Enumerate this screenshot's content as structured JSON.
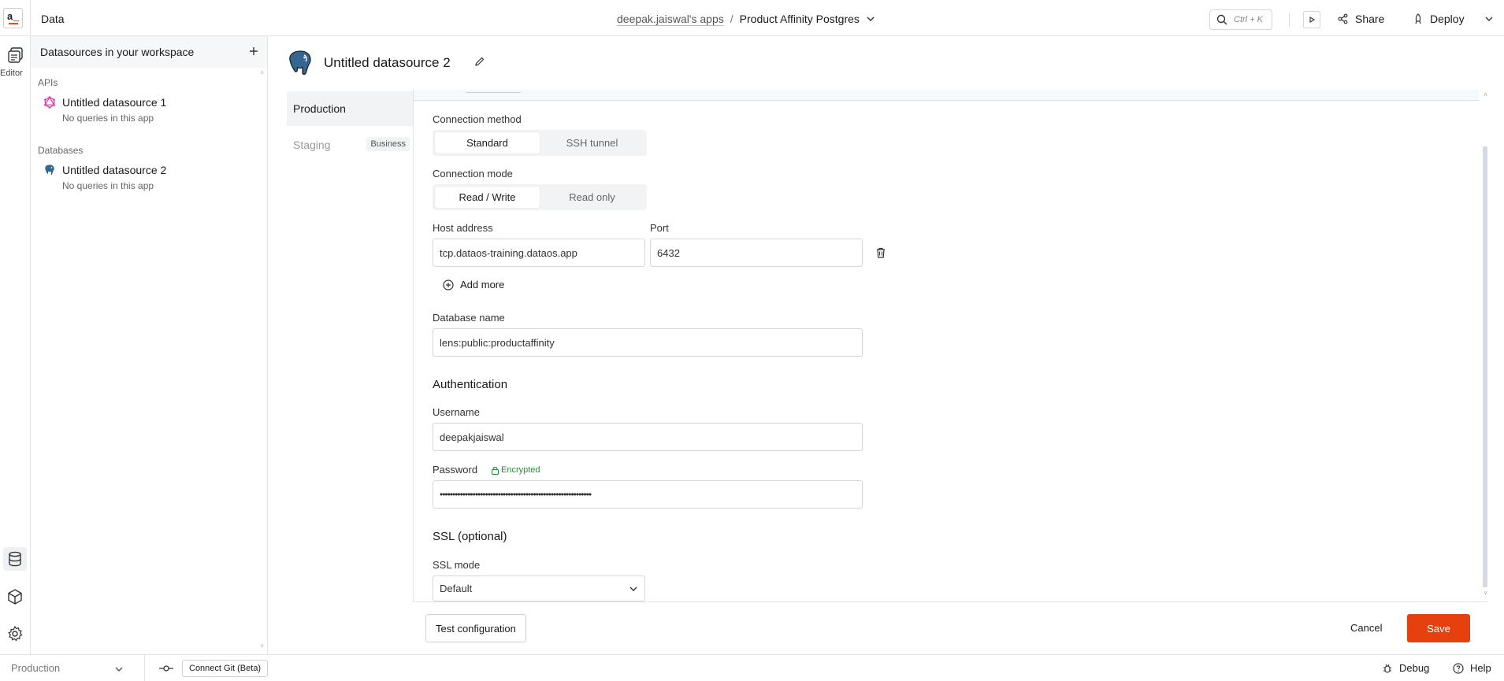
{
  "topbar": {
    "logo_text": "a_",
    "section_title": "Data",
    "workspace": "deepak.jaiswal's apps",
    "separator": "/",
    "app_name": "Product Affinity Postgres",
    "search_shortcut": "Ctrl + K",
    "share_label": "Share",
    "deploy_label": "Deploy"
  },
  "rail": {
    "editor_label": "Editor"
  },
  "sidebar": {
    "header": "Datasources in your workspace",
    "groups": [
      {
        "label": "APIs",
        "items": [
          {
            "name": "Untitled datasource 1",
            "sub": "No queries in this app",
            "icon": "graphql-icon"
          }
        ]
      },
      {
        "label": "Databases",
        "items": [
          {
            "name": "Untitled datasource 2",
            "sub": "No queries in this app",
            "icon": "postgres-icon"
          }
        ]
      }
    ]
  },
  "datasource": {
    "title": "Untitled datasource 2"
  },
  "env_tabs": {
    "production": "Production",
    "staging": "Staging",
    "staging_badge": "Business"
  },
  "form": {
    "connection_method_label": "Connection method",
    "connection_method_options": [
      "Standard",
      "SSH tunnel"
    ],
    "connection_method_selected": "Standard",
    "connection_mode_label": "Connection mode",
    "connection_mode_options": [
      "Read / Write",
      "Read only"
    ],
    "connection_mode_selected": "Read / Write",
    "host_label": "Host address",
    "host_value": "tcp.dataos-training.dataos.app",
    "port_label": "Port",
    "port_value": "6432",
    "add_more": "Add more",
    "db_name_label": "Database name",
    "db_name_value": "lens:public:productaffinity",
    "auth_heading": "Authentication",
    "username_label": "Username",
    "username_value": "deepakjaiswal",
    "password_label": "Password",
    "encrypted_label": "Encrypted",
    "password_value": "••••••••••••••••••••••••••••••••••••••••••••••••••••••••••••",
    "ssl_heading": "SSL (optional)",
    "ssl_mode_label": "SSL mode",
    "ssl_mode_value": "Default"
  },
  "actions": {
    "test_config": "Test configuration",
    "cancel": "Cancel",
    "save": "Save"
  },
  "bottombar": {
    "environment": "Production",
    "connect_git": "Connect Git (Beta)",
    "debug": "Debug",
    "help": "Help"
  },
  "colors": {
    "accent": "#e5400d",
    "encrypted_green": "#2b8a3e"
  }
}
